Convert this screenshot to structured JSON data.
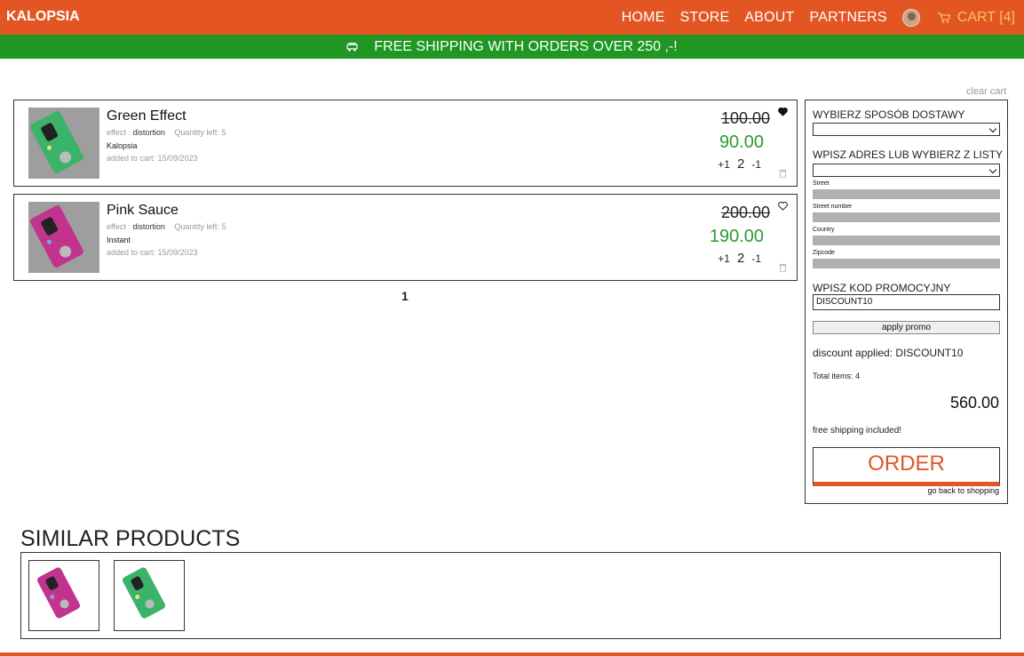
{
  "header": {
    "brand": "KALOPSIA",
    "nav": [
      "HOME",
      "STORE",
      "ABOUT",
      "PARTNERS"
    ],
    "cart_label": "CART [4]",
    "avatar_icon": "user-avatar",
    "cart_icon": "cart-icon",
    "brand_color": "#e35624"
  },
  "banner": {
    "text": "FREE SHIPPING WITH ORDERS OVER 250 ,-!",
    "icon": "truck-icon",
    "color": "#1f9722"
  },
  "clear_cart": "clear cart",
  "items": [
    {
      "name": "Green Effect",
      "effect_label": "effect : ",
      "effect": "distortion",
      "quantity_left": "Quantity left: 5",
      "brand": "Kalopsia",
      "added": "added to cart: 15/09/2023",
      "old_price": "100.00",
      "price": "90.00",
      "plus": "+1",
      "qty": "2",
      "minus": "-1",
      "favorite": true,
      "pedal_color": "#3bb36a"
    },
    {
      "name": "Pink Sauce",
      "effect_label": "effect : ",
      "effect": "distortion",
      "quantity_left": "Quantity left: 5",
      "brand": "Instant",
      "added": "added to cart: 15/09/2023",
      "old_price": "200.00",
      "price": "190.00",
      "plus": "+1",
      "qty": "2",
      "minus": "-1",
      "favorite": false,
      "pedal_color": "#c2338e"
    }
  ],
  "pagination": "1",
  "checkout": {
    "delivery_label": "WYBIERZ SPOSÓB DOSTAWY",
    "address_label": "WPISZ ADRES LUB WYBIERZ Z LISTY",
    "fields": [
      "Street",
      "Street number",
      "Country",
      "Zipcode"
    ],
    "promo_label": "WPISZ KOD PROMOCYJNY",
    "promo_value": "DISCOUNT10",
    "apply_label": "apply promo",
    "discount_applied": "discount applied: DISCOUNT10",
    "total_items": "Total items: 4",
    "total": "560.00",
    "free_shipping": "free shipping included!",
    "order_label": "ORDER",
    "back_label": "go back to shopping"
  },
  "similar": {
    "title": "SIMILAR PRODUCTS",
    "products": [
      {
        "pedal_color": "#c2338e"
      },
      {
        "pedal_color": "#3bb36a"
      }
    ]
  }
}
